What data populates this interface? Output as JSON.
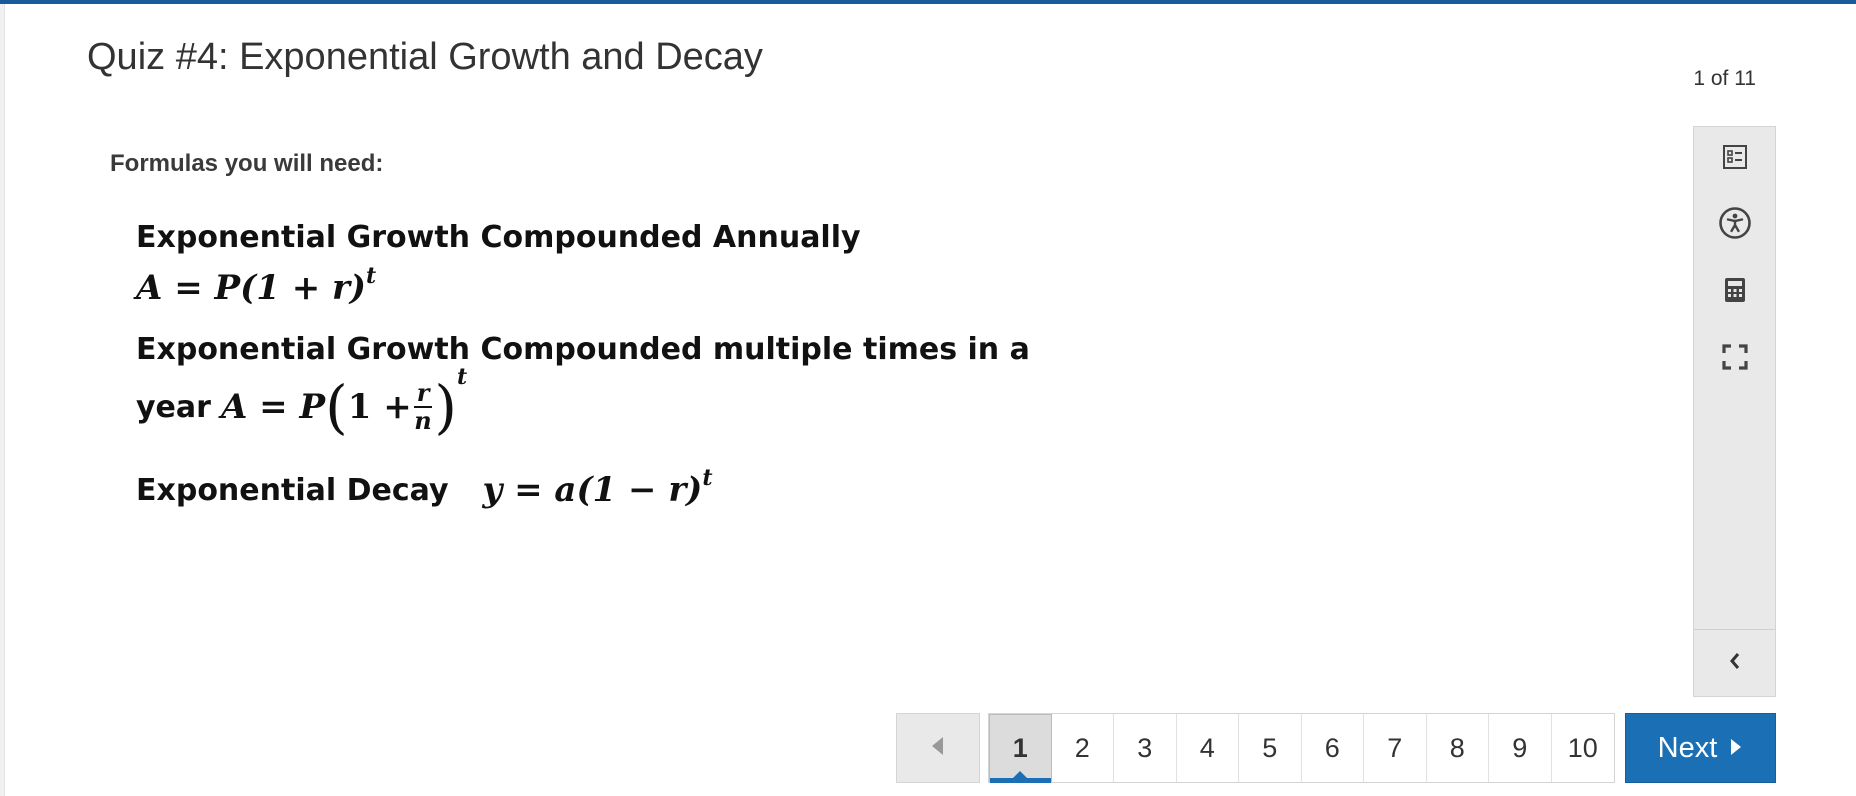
{
  "quiz": {
    "title": "Quiz #4: Exponential Growth and Decay",
    "progress": "1 of 11"
  },
  "content": {
    "heading": "Formulas you will need:",
    "formula1_title": "Exponential Growth Compounded Annually",
    "formula1_eq_base": "A = P(1 + r)",
    "formula1_eq_exp": "t",
    "formula2_title": "Exponential Growth Compounded multiple times in a",
    "formula2_word": "year",
    "formula2_eq_left": "A = P",
    "formula2_one_plus": "1 +",
    "formula2_num": "r",
    "formula2_den": "n",
    "formula2_exp": "t",
    "formula3_word": "Exponential Decay",
    "formula3_eq_base": "y = a(1 − r)",
    "formula3_eq_exp": "t"
  },
  "tools": [
    {
      "name": "question-list-icon"
    },
    {
      "name": "accessibility-icon"
    },
    {
      "name": "calculator-icon"
    },
    {
      "name": "fullscreen-icon"
    },
    {
      "name": "collapse-chevron-icon"
    }
  ],
  "pager": {
    "pages": [
      "1",
      "2",
      "3",
      "4",
      "5",
      "6",
      "7",
      "8",
      "9",
      "10"
    ],
    "current": "1",
    "next_label": "Next"
  },
  "colors": {
    "accent": "#1a6fb5",
    "top_bar": "#1a5a9c",
    "panel": "#e9e9e9"
  }
}
